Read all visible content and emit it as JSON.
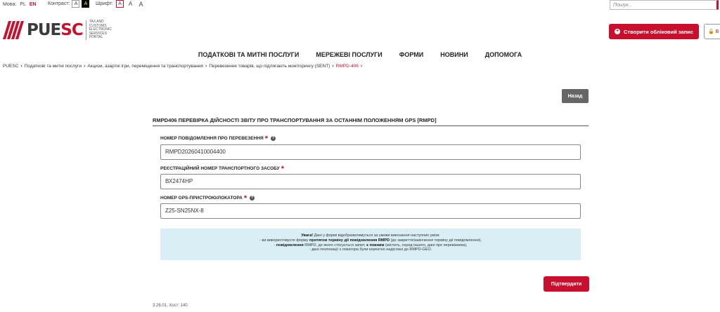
{
  "topbar": {
    "language_label": "Мова:",
    "lang_pl": "PL",
    "lang_en": "EN",
    "contrast_label": "Контраст:",
    "contrast_normal": "A",
    "contrast_high": "A",
    "font_label": "Шрифт:",
    "font_small": "A",
    "font_medium": "A",
    "font_large": "A",
    "search_placeholder": "Пошук..."
  },
  "logo": {
    "word_main": "PUE",
    "word_accent": "SC",
    "tagline": "TAX AND CUSTOMS ELECTRONIC SERVICES PORTAL"
  },
  "header": {
    "create_account_label": "Створити обліковий запис",
    "login_label": "🔓 В"
  },
  "nav": [
    "ПОДАТКОВІ ТА МИТНІ ПОСЛУГИ",
    "МЕРЕЖЕВІ ПОСЛУГИ",
    "ФОРМИ",
    "НОВИНИ",
    "ДОПОМОГА"
  ],
  "breadcrumb": [
    "PUESC",
    "Податкові та митні послуги",
    "Акцизи, азартні ігри, переміщення та транспортування",
    "Перевезення товарів, що підлягають моніторингу (SENT)",
    "RMPD-406"
  ],
  "back_label": "Назад",
  "form": {
    "title": "RMPD406 ПЕРЕВІРКА ДІЙСНОСТІ ЗВІТУ ПРО ТРАНСПОРТУВАННЯ ЗА ОСТАННІМ ПОЛОЖЕННЯМ GPS [RMPD]",
    "fields": [
      {
        "label": "НОМЕР ПОВІДОМЛЕННЯ ПРО ПЕРЕВЕЗЕННЯ",
        "value": "RMPD20260410004400"
      },
      {
        "label": "РЕЄСТРАЦІЙНИЙ НОМЕР ТРАНСПОРТНОГО ЗАСОБУ",
        "value": "ВХ2474НР"
      },
      {
        "label": "НОМЕР GPS-ПРИСТРОЮ/ЛОКАТОРА",
        "value": "Z25-SN25NX-8"
      }
    ],
    "notice": {
      "l1_bold": "Увага!",
      "l1_rest": " Дані у формі відображатимуться за умови виконання наступних умов:",
      "l2_pre": "- ви використовуєте форму ",
      "l2_bold": "протягом терміну дії повідомлення RMPD",
      "l2_post": " (до закриття/закінчення терміну дії повідомлення),",
      "l3_pre": "- ",
      "l3_bold1": "повідомлення",
      "l3_mid": " RMPD, до якого стосується запит, ",
      "l3_bold2": "є повним",
      "l3_post": " (містить, серед іншого, дані про перевізника),",
      "l4": "- дані геолокації з локатора були коректно надіслані до RMPD-GEO."
    },
    "submit_label": "Підтвердити"
  },
  "footer": {
    "version": "3.26.01, Хост: 140"
  },
  "colors": {
    "brand": "#c8102e",
    "notice_bg": "#d9eff5",
    "back_button": "#666666"
  }
}
